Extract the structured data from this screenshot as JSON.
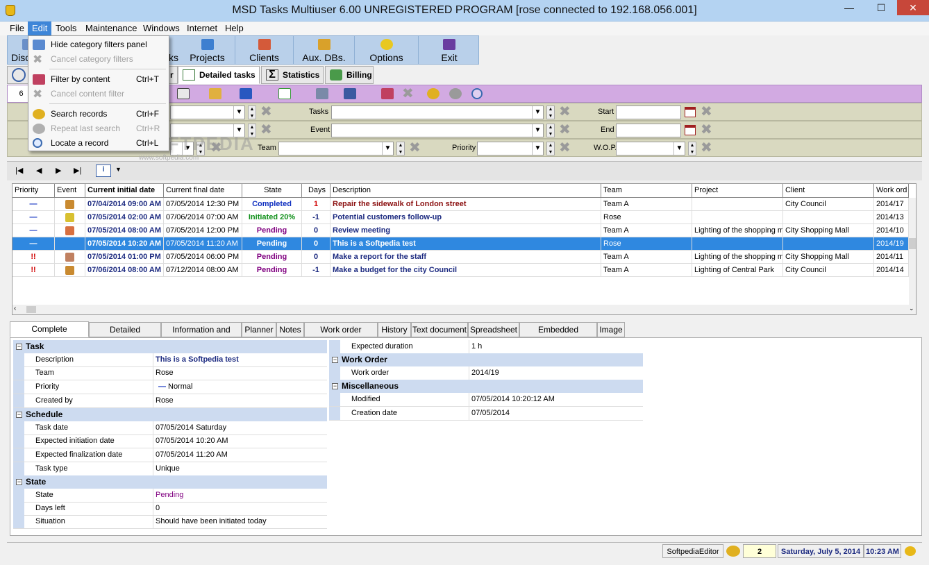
{
  "window": {
    "title": "MSD Tasks Multiuser 6.00 UNREGISTERED PROGRAM [rose connected to 192.168.056.001]",
    "minimize": "—",
    "maximize": "☐",
    "close": "✕"
  },
  "menubar": [
    "File",
    "Edit",
    "Tools",
    "Maintenance",
    "Windows",
    "Internet",
    "Help"
  ],
  "toolbar": {
    "disc": "Disc",
    "tasks": "ks",
    "projects": "Projects",
    "clients": "Clients",
    "aux": "Aux. DBs.",
    "options": "Options",
    "exit": "Exit"
  },
  "view_tabs": {
    "detailed": "Detailed tasks",
    "statistics": "Statistics",
    "billing": "Billing",
    "partial": "r"
  },
  "date_box": "6",
  "filters": {
    "tasks": "Tasks",
    "start": "Start",
    "event": "Event",
    "end": "End",
    "team": "Team",
    "priority": "Priority",
    "wop": "W.O.P."
  },
  "watermark": "SOFTPEDIA",
  "watermark_url": "www.softpedia.com",
  "grid": {
    "headers": [
      "Priority",
      "Event",
      "Current initial date",
      "Current final date",
      "State",
      "Days",
      "Description",
      "Team",
      "Project",
      "Client",
      "Work ord"
    ],
    "rows": [
      {
        "priority": "—",
        "cid": "07/04/2014 09:00 AM",
        "cfd": "07/05/2014 12:30 PM",
        "state": "Completed",
        "days": "1",
        "desc": "Repair the sidewalk of London street",
        "team": "Team A",
        "project": "",
        "client": "City Council",
        "wo": "2014/17"
      },
      {
        "priority": "—",
        "cid": "07/05/2014 02:00 AM",
        "cfd": "07/06/2014 07:00 AM",
        "state": "Initiated 20%",
        "days": "-1",
        "desc": "Potential customers follow-up",
        "team": "Rose",
        "project": "",
        "client": "",
        "wo": "2014/13"
      },
      {
        "priority": "—",
        "cid": "07/05/2014 08:00 AM",
        "cfd": "07/05/2014 12:00 PM",
        "state": "Pending",
        "days": "0",
        "desc": "Review meeting",
        "team": "Team A",
        "project": "Lighting of the shopping ma",
        "client": "City Shopping Mall",
        "wo": "2014/10"
      },
      {
        "priority": "—",
        "cid": "07/05/2014 10:20 AM",
        "cfd": "07/05/2014 11:20 AM",
        "state": "Pending",
        "days": "0",
        "desc": "This is a Softpedia test",
        "team": "Rose",
        "project": "",
        "client": "",
        "wo": "2014/19"
      },
      {
        "priority": "!!",
        "cid": "07/05/2014 01:00 PM",
        "cfd": "07/05/2014 06:00 PM",
        "state": "Pending",
        "days": "0",
        "desc": "Make a report for the staff",
        "team": "Team A",
        "project": "Lighting of the shopping ma",
        "client": "City Shopping Mall",
        "wo": "2014/11"
      },
      {
        "priority": "!!",
        "cid": "07/06/2014 08:00 AM",
        "cfd": "07/12/2014 08:00 AM",
        "state": "Pending",
        "days": "-1",
        "desc": "Make a budget for the city Council",
        "team": "Team A",
        "project": "Lighting of Central Park",
        "client": "City Council",
        "wo": "2014/14"
      }
    ]
  },
  "detail_tabs": [
    "Complete information",
    "Detailed information",
    "Information and notes",
    "Planner",
    "Notes",
    "Work order remarks",
    "History",
    "Text document",
    "Spreadsheet",
    "Embedded document",
    "Image"
  ],
  "detail": {
    "task_head": "Task",
    "description_k": "Description",
    "description_v": "This is a Softpedia test",
    "team_k": "Team",
    "team_v": "Rose",
    "priority_k": "Priority",
    "priority_v": "Normal",
    "priority_mark": "—",
    "created_k": "Created by",
    "created_v": "Rose",
    "schedule_head": "Schedule",
    "taskdate_k": "Task date",
    "taskdate_v": "07/05/2014 Saturday",
    "expinit_k": "Expected initiation date",
    "expinit_v": "07/05/2014 10:20 AM",
    "expfin_k": "Expected finalization date",
    "expfin_v": "07/05/2014 11:20 AM",
    "tasktype_k": "Task type",
    "tasktype_v": "Unique",
    "state_head": "State",
    "state_k": "State",
    "state_v": "Pending",
    "daysleft_k": "Days left",
    "daysleft_v": "0",
    "situation_k": "Situation",
    "situation_v": "Should have been initiated today",
    "expdur_k": "Expected duration",
    "expdur_v": "1 h",
    "wo_head": "Work Order",
    "wo_k": "Work order",
    "wo_v": "2014/19",
    "misc_head": "Miscellaneous",
    "modified_k": "Modified",
    "modified_v": "07/05/2014 10:20:12 AM",
    "creation_k": "Creation date",
    "creation_v": "07/05/2014"
  },
  "status": {
    "user": "SoftpediaEditor",
    "count": "2",
    "date": "Saturday, July 5, 2014",
    "time": "10:23 AM"
  },
  "edit_menu": {
    "hide_filters": "Hide category filters panel",
    "cancel_filters": "Cancel category filters",
    "filter_content": "Filter by content",
    "filter_content_sc": "Ctrl+T",
    "cancel_content": "Cancel content filter",
    "search": "Search records",
    "search_sc": "Ctrl+F",
    "repeat": "Repeat last search",
    "repeat_sc": "Ctrl+R",
    "locate": "Locate a record",
    "locate_sc": "Ctrl+L"
  },
  "colors": {
    "selected_row": "#2f88e0",
    "completed": "#1030c0",
    "initiated": "#10901a",
    "pending": "#800080",
    "desc": "#8b1010",
    "purple_bar": "#d2aae2"
  }
}
